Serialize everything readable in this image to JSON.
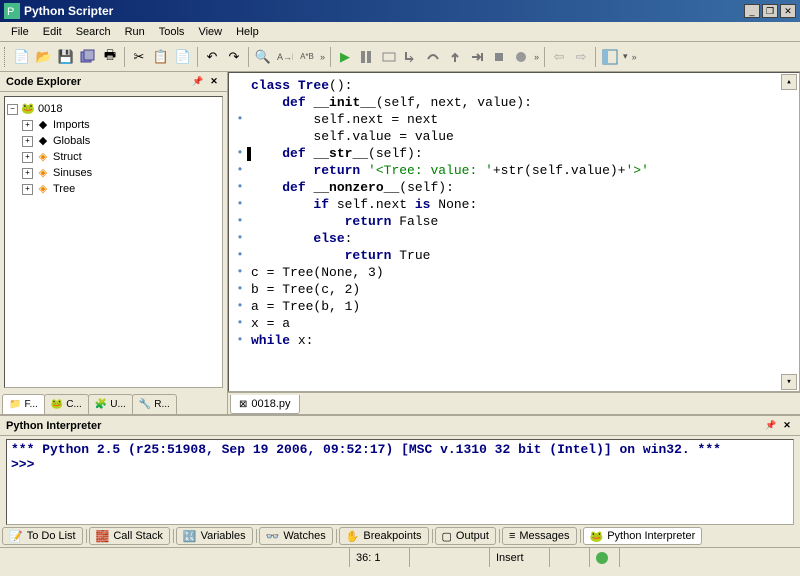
{
  "app": {
    "title": "Python Scripter"
  },
  "menus": [
    "File",
    "Edit",
    "Search",
    "Run",
    "Tools",
    "View",
    "Help"
  ],
  "toolbar": {
    "buttons": [
      "new",
      "open",
      "save",
      "saveall",
      "print",
      "sep",
      "cut",
      "copy",
      "paste",
      "sep",
      "undo",
      "redo",
      "sep",
      "find",
      "replace",
      "findword",
      "chev",
      "sep",
      "run",
      "pause",
      "debug",
      "stepinto",
      "stepover",
      "stepout",
      "runto",
      "stop",
      "toggle",
      "chev",
      "sep",
      "back",
      "fwd",
      "up",
      "sep",
      "layout",
      "chev"
    ]
  },
  "code_explorer": {
    "title": "Code Explorer",
    "root": "0018",
    "children": [
      "Imports",
      "Globals",
      "Struct",
      "Sinuses",
      "Tree"
    ]
  },
  "left_tabs": [
    {
      "label": "F..."
    },
    {
      "label": "C..."
    },
    {
      "label": "U..."
    },
    {
      "label": "R..."
    }
  ],
  "editor": {
    "filename": "0018.py",
    "lines": [
      {
        "dot": false,
        "html": "<span class='kw'>class</span> <span class='cls'>Tree</span>():"
      },
      {
        "dot": false,
        "html": "    <span class='kw'>def</span> <span class='mg'>__init__</span>(self, next, value):"
      },
      {
        "dot": true,
        "html": "        self.next = next"
      },
      {
        "dot": false,
        "html": "        self.value = value",
        "caret": true
      },
      {
        "dot": true,
        "html": "    <span class='kw'>def</span> <span class='mg'>__str__</span>(self):",
        "caretstart": true
      },
      {
        "dot": true,
        "html": "        <span class='kw'>return</span> <span class='str'>'&lt;Tree: value: '</span>+str(self.value)+<span class='str'>'&gt;'</span>"
      },
      {
        "dot": true,
        "html": "    <span class='kw'>def</span> <span class='mg'>__nonzero__</span>(self):"
      },
      {
        "dot": true,
        "html": "        <span class='kw'>if</span> self.next <span class='kw'>is</span> None:"
      },
      {
        "dot": true,
        "html": "            <span class='kw'>return</span> False"
      },
      {
        "dot": true,
        "html": "        <span class='kw'>else</span>:"
      },
      {
        "dot": true,
        "html": "            <span class='kw'>return</span> True"
      },
      {
        "dot": false,
        "html": ""
      },
      {
        "dot": true,
        "html": "c = Tree(None, 3)"
      },
      {
        "dot": true,
        "html": "b = Tree(c, 2)"
      },
      {
        "dot": true,
        "html": "a = Tree(b, 1)"
      },
      {
        "dot": false,
        "html": ""
      },
      {
        "dot": true,
        "html": "x = a"
      },
      {
        "dot": true,
        "html": "<span class='kw'>while</span> x:"
      }
    ]
  },
  "interpreter": {
    "title": "Python Interpreter",
    "banner": "*** Python 2.5 (r25:51908, Sep 19 2006, 09:52:17) [MSC v.1310 32 bit (Intel)] on win32. ***",
    "prompt": ">>>"
  },
  "bottom_tabs": [
    "To Do List",
    "Call Stack",
    "Variables",
    "Watches",
    "Breakpoints",
    "Output",
    "Messages",
    "Python Interpreter"
  ],
  "status": {
    "pos": "36: 1",
    "mode": "Insert"
  }
}
